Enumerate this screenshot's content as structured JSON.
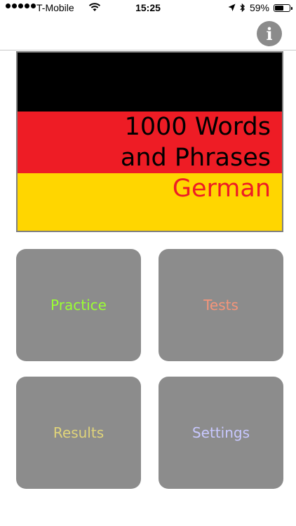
{
  "status_bar": {
    "carrier": "T-Mobile",
    "time": "15:25",
    "battery": "59%",
    "battery_level": 0.59,
    "icons": [
      "signal-dots-icon",
      "wifi-icon",
      "location-arrow-icon",
      "bluetooth-icon",
      "battery-icon"
    ]
  },
  "header": {
    "info_icon_glyph": "i"
  },
  "banner": {
    "line1": "1000 Words",
    "line2": "and Phrases",
    "line3": "German",
    "colors": {
      "black": "#000000",
      "red": "#ee1c25",
      "gold": "#ffd600"
    }
  },
  "menu": {
    "tiles": [
      {
        "label": "Practice",
        "color": "#9bff33"
      },
      {
        "label": "Tests",
        "color": "#f5957a"
      },
      {
        "label": "Results",
        "color": "#e0d47a"
      },
      {
        "label": "Settings",
        "color": "#c8c8ff"
      }
    ],
    "tile_color": "#8c8c8c"
  }
}
